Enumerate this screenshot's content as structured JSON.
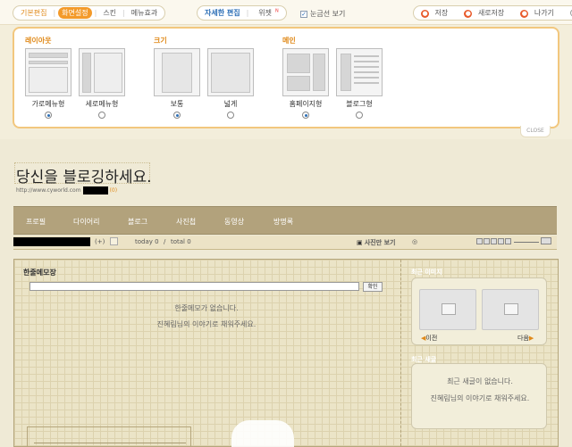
{
  "toolbar": {
    "group1": [
      "기본편집",
      "화면설정",
      "스킨",
      "메뉴효과"
    ],
    "group2": [
      "자세한 편집",
      "위젯"
    ],
    "widget_badge": "N",
    "gridlines_label": "눈금선 보기",
    "save": "저장",
    "save_new": "새로저장",
    "exit": "나가기",
    "help": "?"
  },
  "settings": {
    "layout_title": "레이아웃",
    "layout_options": [
      "가로메뉴형",
      "세로메뉴형"
    ],
    "size_title": "크기",
    "size_options": [
      "보통",
      "넓게"
    ],
    "type_title": "메인",
    "type_options": [
      "홈페이지형",
      "블로그형"
    ],
    "close": "CLOSE"
  },
  "blog": {
    "title": "당신을 블로깅하세요.",
    "url": "http://www.cyworld.com",
    "url_suffix": "(0)",
    "nav": [
      "프로필",
      "다이어리",
      "블로그",
      "사진첩",
      "동영상",
      "방명록"
    ],
    "status": {
      "plus": "(+)",
      "today": "today 0",
      "slash": "/",
      "total": "total 0",
      "photo_only": "사진만 보기"
    }
  },
  "memo": {
    "title": "한줄메모장",
    "confirm": "확인",
    "empty1": "한줄메모가 없습니다.",
    "empty2": "진혜림님의 이야기로 채워주세요."
  },
  "recent_images": {
    "title": "최근 이미지",
    "prev": "이전",
    "next": "다음"
  },
  "recent_posts": {
    "title": "최근 새글",
    "empty1": "최근 새글이 없습니다.",
    "empty2": "진혜림님의 이야기로 채워주세요."
  },
  "colors": {
    "accent": "#f39a2a",
    "link": "#2d6fb6",
    "nav_bg": "#b2a27c",
    "panel_border": "#f2c77e"
  }
}
